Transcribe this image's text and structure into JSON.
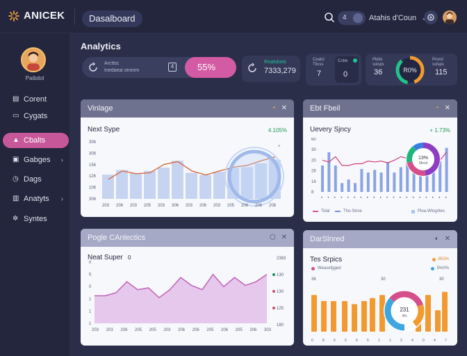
{
  "header": {
    "brand": "ANICEK",
    "page_pill": "Dasalboard",
    "toggle_glyph": "4",
    "user_menu": "Atahis d'Coun"
  },
  "sidebar": {
    "user_name": "Paibdol",
    "items": [
      {
        "label": "Corent",
        "icon": "layout-icon",
        "active": false
      },
      {
        "label": "Cygats",
        "icon": "document-icon",
        "active": false
      },
      {
        "label": "Cbalts",
        "icon": "triangle-icon",
        "active": true
      },
      {
        "label": "Gabges",
        "icon": "briefcase-icon",
        "active": false,
        "chevron": true
      },
      {
        "label": "Dags",
        "icon": "clock-icon",
        "active": false
      },
      {
        "label": "Anatyts",
        "icon": "chart-icon",
        "active": false,
        "chevron": true
      },
      {
        "label": "Syntes",
        "icon": "gear-icon",
        "active": false
      }
    ]
  },
  "main": {
    "title": "Analytics",
    "stats": {
      "s1_label": "Arcttsc",
      "s1_sub": "Inedaeai stronm",
      "s1_box": "4",
      "s1_value": "55%",
      "s2_label": "Ilrsatsbots",
      "s2_value": "7333,279",
      "s3_label_a": "Cealcl",
      "s3_label_a2": "Tlicss",
      "s3_value_a": "7",
      "s3_label_b": "Cnbe",
      "s3_value_b": "0",
      "s4_label_a": "Pbilsi",
      "s4_label_a2": "sslsps",
      "s4_value_a": "36",
      "s4_ring": "R0%",
      "s4_label_b": "Prorsl",
      "s4_label_b2": "sslsps",
      "s4_value_b": "115"
    }
  },
  "cards": {
    "c1": {
      "title": "Vinlage",
      "subtitle": "Next Sype",
      "metric": "4.105%",
      "y_ticks": [
        "306",
        "306",
        "156",
        "126",
        "106",
        "306"
      ],
      "x_ticks": [
        "203",
        "206",
        "203",
        "205",
        "203",
        "306",
        "203",
        "206",
        "203",
        "205",
        "208",
        "206",
        "208"
      ]
    },
    "c2": {
      "title": "Ebt Fbeil",
      "subtitle": "Uevery Sjncy",
      "metric": "+ 1.73%",
      "y_ticks": [
        "60",
        "30",
        "20",
        "26",
        "16",
        "8"
      ],
      "ring_value": "13%",
      "ring_sub": "Sfeorl",
      "legend_a": "Tolal",
      "legend_b": "Tho-Stroe",
      "legend_c": "Ploa-Wlogrites"
    },
    "c3": {
      "title": "Pogle CAnlectics",
      "subtitle": "Neat Super",
      "badge": "0",
      "y_ticks": [
        "0",
        "5",
        "0",
        "1",
        "1",
        "1"
      ],
      "right_ticks": [
        "2383",
        "130",
        "130",
        "125",
        "180"
      ],
      "x_ticks": [
        "203",
        "203",
        "208",
        "205",
        "205",
        "203",
        "206",
        "206",
        "205",
        "206",
        "205",
        "206",
        "303"
      ]
    },
    "c4": {
      "title": "DarSlnred",
      "subtitle": "Tes Srpics",
      "legend_label": "Weasefgged",
      "metric_a": "853%",
      "metric_b": "5%0%",
      "tick_left": "36",
      "tick_mid": "30",
      "tick_right": "30",
      "ring_value": "231",
      "ring_sub": "4%",
      "x_ticks": [
        "0",
        "8",
        "5",
        "5",
        "5",
        "5",
        "1",
        "1",
        "3",
        "4",
        "0",
        "4",
        "7"
      ]
    }
  },
  "chart_data": [
    {
      "type": "bar",
      "title": "Vinlage",
      "categories": [
        "203",
        "206",
        "203",
        "205",
        "203",
        "306",
        "203",
        "206",
        "203",
        "205",
        "208",
        "206",
        "208"
      ],
      "series": [
        {
          "values": [
            130,
            155,
            138,
            150,
            168,
            205,
            140,
            128,
            145,
            165,
            170,
            190,
            210
          ]
        }
      ],
      "line": [
        105,
        150,
        135,
        140,
        185,
        200,
        150,
        128,
        150,
        170,
        180,
        205,
        225
      ],
      "ylim": [
        0,
        306
      ]
    },
    {
      "type": "bar",
      "title": "Ebt Fbeil",
      "series": [
        {
          "values": [
            30,
            45,
            30,
            10,
            14,
            10,
            26,
            22,
            25,
            22,
            34,
            22,
            28,
            40,
            32,
            44,
            48,
            44,
            35,
            50
          ]
        }
      ],
      "line": [
        36,
        34,
        40,
        30,
        30,
        32,
        32,
        35,
        34,
        35,
        33,
        36,
        40,
        38,
        34,
        36,
        40,
        42,
        36,
        45
      ],
      "ylim": [
        0,
        60
      ]
    },
    {
      "type": "area",
      "title": "Pogle CAnlectics",
      "values": [
        45,
        45,
        50,
        68,
        55,
        58,
        42,
        55,
        75,
        62,
        55,
        80,
        60,
        75,
        62,
        68,
        80
      ],
      "ylim": [
        0,
        100
      ]
    },
    {
      "type": "bar",
      "title": "DarSlnred",
      "series": [
        {
          "values": [
            24,
            20,
            20,
            20,
            18,
            20,
            22,
            24,
            12,
            24,
            14,
            26
          ]
        }
      ],
      "ylim": [
        0,
        30
      ]
    }
  ]
}
